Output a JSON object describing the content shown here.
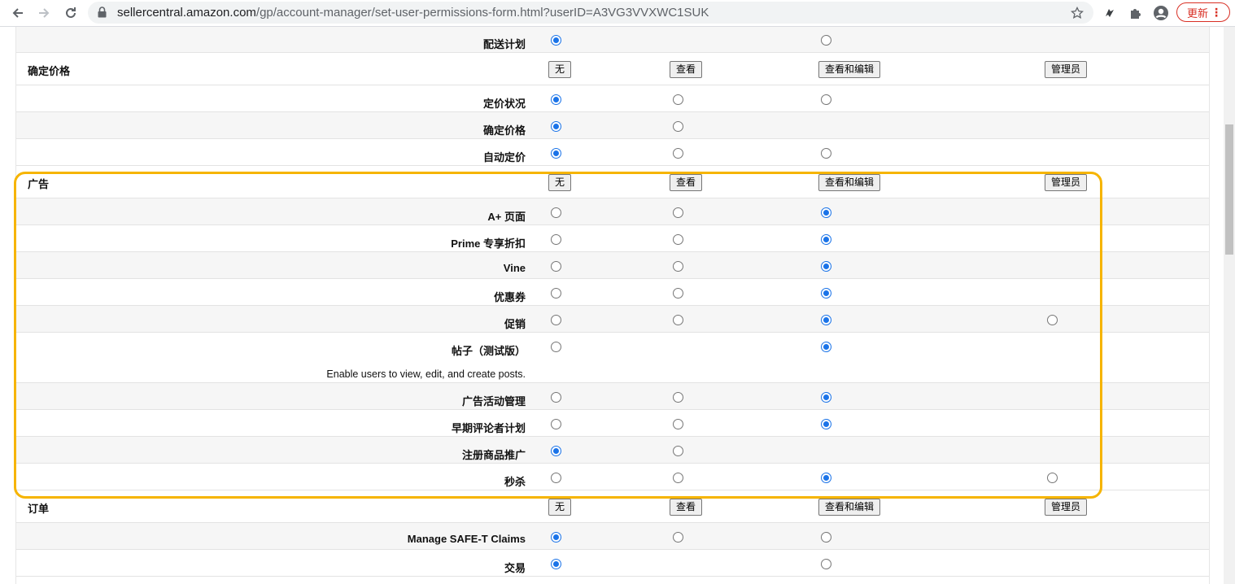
{
  "browser": {
    "url_host": "sellercentral.amazon.com",
    "url_path": "/gp/account-manager/set-user-permissions-form.html?userID=A3VG3VVXWC1SUK",
    "update_label": "更新"
  },
  "columns": [
    "无",
    "查看",
    "查看和编辑",
    "管理员"
  ],
  "rows": [
    {
      "kind": "perm",
      "label": "配送计划",
      "shade": true,
      "radios": [
        "checked",
        "",
        "unchecked",
        ""
      ]
    },
    {
      "kind": "section",
      "title": "确定价格",
      "buttons": [
        "无",
        "查看",
        "查看和编辑",
        "管理员"
      ]
    },
    {
      "kind": "perm",
      "label": "定价状况",
      "radios": [
        "checked",
        "unchecked",
        "unchecked",
        ""
      ]
    },
    {
      "kind": "perm",
      "label": "确定价格",
      "shade": true,
      "radios": [
        "checked",
        "unchecked",
        "",
        ""
      ]
    },
    {
      "kind": "perm",
      "label": "自动定价",
      "radios": [
        "checked",
        "unchecked",
        "unchecked",
        ""
      ]
    },
    {
      "kind": "section",
      "title": "广告",
      "buttons": [
        "无",
        "查看",
        "查看和编辑",
        "管理员"
      ]
    },
    {
      "kind": "perm",
      "label": "A+ 页面",
      "shade": true,
      "radios": [
        "unchecked",
        "unchecked",
        "checked",
        ""
      ]
    },
    {
      "kind": "perm",
      "label": "Prime 专享折扣",
      "radios": [
        "unchecked",
        "unchecked",
        "checked",
        ""
      ]
    },
    {
      "kind": "perm",
      "label": "Vine",
      "shade": true,
      "radios": [
        "unchecked",
        "unchecked",
        "checked",
        ""
      ]
    },
    {
      "kind": "perm",
      "label": "优惠券",
      "radios": [
        "unchecked",
        "unchecked",
        "checked",
        ""
      ]
    },
    {
      "kind": "perm",
      "label": "促销",
      "shade": true,
      "radios": [
        "unchecked",
        "unchecked",
        "checked",
        "unchecked"
      ]
    },
    {
      "kind": "perm",
      "label": "帖子（测试版）",
      "desc": "Enable users to view, edit, and create posts.",
      "radios": [
        "unchecked",
        "",
        "checked",
        ""
      ]
    },
    {
      "kind": "perm",
      "label": "广告活动管理",
      "shade": true,
      "radios": [
        "unchecked",
        "unchecked",
        "checked",
        ""
      ]
    },
    {
      "kind": "perm",
      "label": "早期评论者计划",
      "radios": [
        "unchecked",
        "unchecked",
        "checked",
        ""
      ]
    },
    {
      "kind": "perm",
      "label": "注册商品推广",
      "shade": true,
      "radios": [
        "checked",
        "unchecked",
        "",
        ""
      ]
    },
    {
      "kind": "perm",
      "label": "秒杀",
      "radios": [
        "unchecked",
        "unchecked",
        "checked",
        "unchecked"
      ]
    },
    {
      "kind": "section",
      "title": "订单",
      "buttons": [
        "无",
        "查看",
        "查看和编辑",
        "管理员"
      ]
    },
    {
      "kind": "perm",
      "label": "Manage SAFE-T Claims",
      "shade": true,
      "radios": [
        "checked",
        "unchecked",
        "unchecked",
        ""
      ]
    },
    {
      "kind": "perm",
      "label": "交易",
      "radios": [
        "checked",
        "",
        "unchecked",
        ""
      ]
    }
  ],
  "colors": {
    "highlight": "#f6b400",
    "radio_checked": "#1a73e8",
    "update": "#d93025"
  }
}
